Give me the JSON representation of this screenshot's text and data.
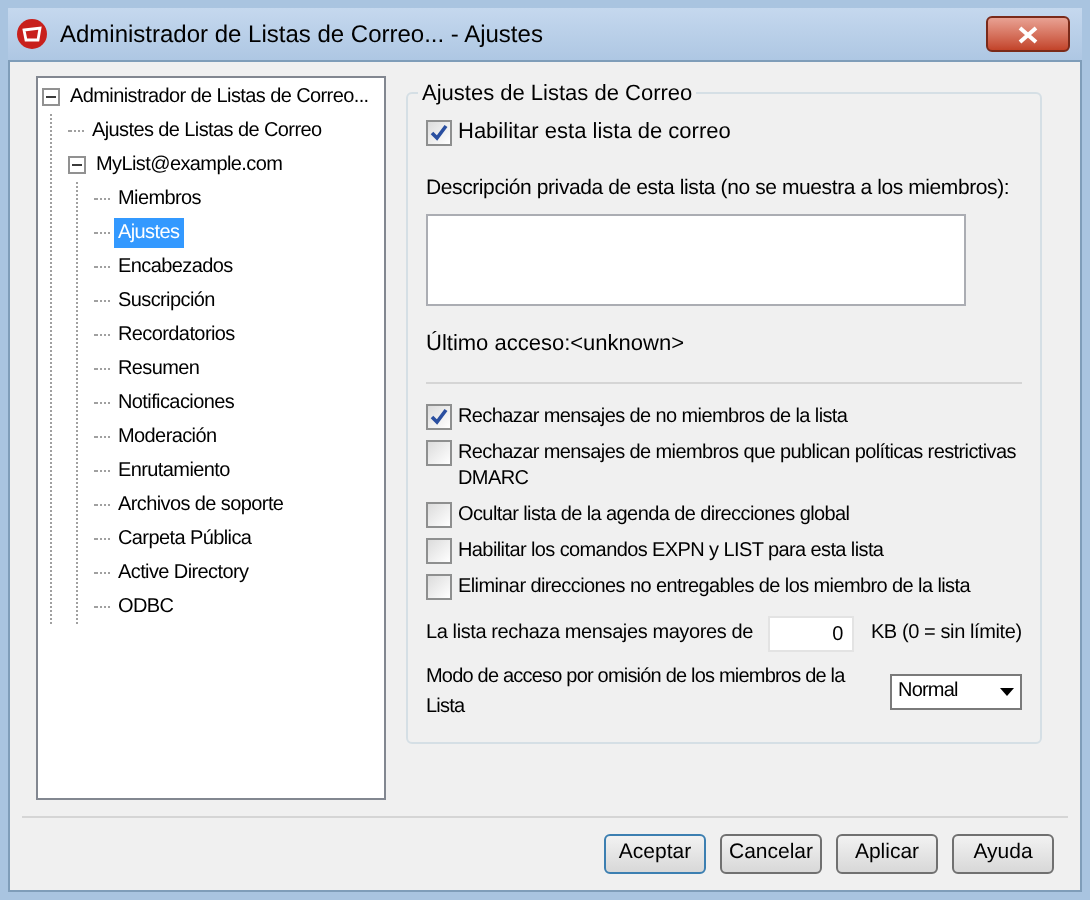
{
  "window": {
    "title": "Administrador de Listas de Correo... - Ajustes"
  },
  "tree": [
    {
      "label": "Administrador de Listas de Correo...",
      "selected": false,
      "expanded": true,
      "children": [
        {
          "label": "Ajustes de Listas de Correo",
          "selected": false
        },
        {
          "label": "MyList@example.com",
          "selected": false,
          "expanded": true,
          "children": [
            {
              "label": "Miembros",
              "selected": false
            },
            {
              "label": "Ajustes",
              "selected": true
            },
            {
              "label": "Encabezados",
              "selected": false
            },
            {
              "label": "Suscripción",
              "selected": false
            },
            {
              "label": "Recordatorios",
              "selected": false
            },
            {
              "label": "Resumen",
              "selected": false
            },
            {
              "label": "Notificaciones",
              "selected": false
            },
            {
              "label": "Moderación",
              "selected": false
            },
            {
              "label": "Enrutamiento",
              "selected": false
            },
            {
              "label": "Archivos de soporte",
              "selected": false
            },
            {
              "label": "Carpeta Pública",
              "selected": false
            },
            {
              "label": "Active Directory",
              "selected": false
            },
            {
              "label": "ODBC",
              "selected": false
            }
          ]
        }
      ]
    }
  ],
  "group": {
    "title": "Ajustes de Listas de Correo",
    "enable": {
      "label": "Habilitar esta lista de correo",
      "checked": true
    },
    "description_label": "Descripción privada de esta lista (no se muestra a los miembros):",
    "last_access": "Último acceso:<unknown>",
    "options": [
      {
        "label": "Rechazar mensajes de no miembros de la lista",
        "checked": true
      },
      {
        "label": "Rechazar mensajes de miembros que publican políticas restrictivas DMARC",
        "checked": false
      },
      {
        "label": "Ocultar lista de la agenda de direcciones global",
        "checked": false
      },
      {
        "label": "Habilitar los comandos EXPN y LIST para esta lista",
        "checked": false
      },
      {
        "label": "Eliminar direcciones no entregables de los miembro de la lista",
        "checked": false
      }
    ],
    "size_label": "La lista rechaza mensajes mayores de",
    "size_value": "0",
    "size_unit": "KB (0 = sin límite)",
    "mode_label": "Modo de acceso por omisión de los miembros de la Lista",
    "mode_value": "Normal"
  },
  "buttons": [
    "Aceptar",
    "Cancelar",
    "Aplicar",
    "Ayuda"
  ]
}
